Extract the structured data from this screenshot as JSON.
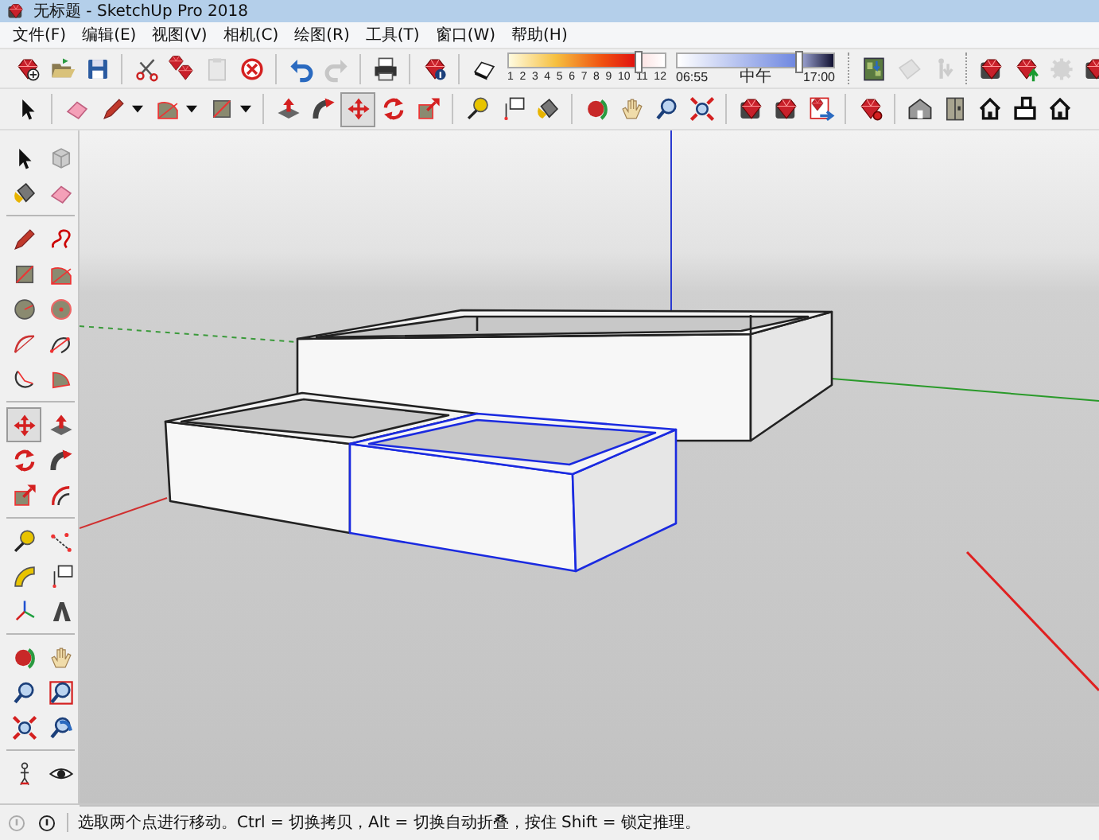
{
  "window": {
    "title": "无标题 - SketchUp Pro 2018"
  },
  "menu": [
    "文件(F)",
    "编辑(E)",
    "视图(V)",
    "相机(C)",
    "绘图(R)",
    "工具(T)",
    "窗口(W)",
    "帮助(H)"
  ],
  "toolbar_1": {
    "left_groups": [
      {
        "tools": [
          {
            "kind": "new",
            "disabled": false
          },
          {
            "kind": "open",
            "disabled": false
          },
          {
            "kind": "save",
            "disabled": false
          }
        ]
      },
      {
        "tools": [
          {
            "kind": "cut",
            "disabled": false
          },
          {
            "kind": "copy",
            "disabled": false
          },
          {
            "kind": "paste",
            "disabled": true
          },
          {
            "kind": "delete",
            "disabled": false
          }
        ]
      },
      {
        "tools": [
          {
            "kind": "undo",
            "disabled": false
          },
          {
            "kind": "redo",
            "disabled": true
          }
        ]
      },
      {
        "tools": [
          {
            "kind": "print",
            "disabled": false
          }
        ]
      },
      {
        "tools": [
          {
            "kind": "info",
            "disabled": false
          }
        ]
      },
      {
        "tools": [
          {
            "kind": "shadows",
            "disabled": false
          }
        ]
      }
    ],
    "shadow_settings": {
      "date_slider": {
        "labels": [
          "1",
          "2",
          "3",
          "4",
          "5",
          "6",
          "7",
          "8",
          "9",
          "10",
          "11",
          "12"
        ],
        "level": 0.83
      },
      "time_slider": {
        "labels": [
          "06:55",
          "中午",
          "17:00"
        ],
        "level": 0.78
      }
    },
    "right_groups": [
      {
        "tools": [
          {
            "kind": "matchphoto",
            "disabled": false
          },
          {
            "kind": "plane",
            "disabled": true
          },
          {
            "kind": "figure",
            "disabled": true
          }
        ]
      },
      {
        "tools": [
          {
            "kind": "ruby",
            "disabled": false
          },
          {
            "kind": "rubyup",
            "disabled": false
          },
          {
            "kind": "rubygear",
            "disabled": true
          },
          {
            "kind": "ruby",
            "disabled": false
          }
        ]
      }
    ]
  },
  "toolbar_2": {
    "groups": [
      {
        "tools": [
          {
            "kind": "select",
            "selected": false
          }
        ]
      },
      {
        "tools": [
          {
            "kind": "eraser",
            "selected": false
          },
          {
            "kind": "pencil",
            "selected": false,
            "dropdown": true
          },
          {
            "kind": "rotrect",
            "selected": false,
            "dropdown": true
          },
          {
            "kind": "rect",
            "selected": false,
            "dropdown": true
          }
        ]
      },
      {
        "tools": [
          {
            "kind": "push",
            "selected": false
          },
          {
            "kind": "follow",
            "selected": false
          },
          {
            "kind": "move",
            "selected": true
          },
          {
            "kind": "rotate",
            "selected": false
          },
          {
            "kind": "scale",
            "selected": false
          }
        ]
      },
      {
        "tools": [
          {
            "kind": "tape",
            "selected": false
          },
          {
            "kind": "text",
            "selected": false
          },
          {
            "kind": "paint",
            "selected": false
          }
        ]
      },
      {
        "tools": [
          {
            "kind": "orbit",
            "selected": false
          },
          {
            "kind": "pan",
            "selected": false
          },
          {
            "kind": "zoom",
            "selected": false
          },
          {
            "kind": "extents",
            "selected": false
          }
        ]
      },
      {
        "tools": [
          {
            "kind": "ruby",
            "selected": false
          },
          {
            "kind": "ruby",
            "selected": false
          },
          {
            "kind": "rubydoc",
            "selected": false
          }
        ]
      },
      {
        "tools": [
          {
            "kind": "rubypin",
            "selected": false
          }
        ]
      },
      {
        "tools": [
          {
            "kind": "house",
            "selected": false
          },
          {
            "kind": "door",
            "selected": false
          },
          {
            "kind": "houseout",
            "selected": false
          },
          {
            "kind": "housebox",
            "selected": false
          },
          {
            "kind": "houseout",
            "selected": false
          }
        ]
      }
    ]
  },
  "left_toolbar": {
    "groups": [
      {
        "tools": [
          {
            "kind": "select",
            "selected": false
          },
          {
            "kind": "component",
            "selected": false
          },
          {
            "kind": "paint",
            "selected": false
          },
          {
            "kind": "eraser",
            "selected": false
          }
        ]
      },
      {
        "tools": [
          {
            "kind": "pencil",
            "selected": false
          },
          {
            "kind": "freehand",
            "selected": false
          },
          {
            "kind": "rect",
            "selected": false
          },
          {
            "kind": "rotrect",
            "selected": false
          },
          {
            "kind": "circle",
            "selected": false
          },
          {
            "kind": "polygon",
            "selected": false
          },
          {
            "kind": "arc2",
            "selected": false
          },
          {
            "kind": "arc3",
            "selected": false
          },
          {
            "kind": "arc",
            "selected": false
          },
          {
            "kind": "pie",
            "selected": false
          }
        ]
      },
      {
        "tools": [
          {
            "kind": "move",
            "selected": true
          },
          {
            "kind": "push",
            "selected": false
          },
          {
            "kind": "rotate",
            "selected": false
          },
          {
            "kind": "follow",
            "selected": false
          },
          {
            "kind": "scale",
            "selected": false
          },
          {
            "kind": "offset",
            "selected": false
          }
        ]
      },
      {
        "tools": [
          {
            "kind": "tape",
            "selected": false
          },
          {
            "kind": "dimension",
            "selected": false
          },
          {
            "kind": "protractor",
            "selected": false
          },
          {
            "kind": "text",
            "selected": false
          },
          {
            "kind": "axes",
            "selected": false
          },
          {
            "kind": "text3d",
            "selected": false
          }
        ]
      },
      {
        "tools": [
          {
            "kind": "orbit",
            "selected": false
          },
          {
            "kind": "pan",
            "selected": false
          },
          {
            "kind": "zoom",
            "selected": false
          },
          {
            "kind": "zoomwin",
            "selected": false
          },
          {
            "kind": "extents",
            "selected": false
          },
          {
            "kind": "previous",
            "selected": false
          }
        ]
      },
      {
        "tools": [
          {
            "kind": "position",
            "selected": false
          },
          {
            "kind": "look",
            "selected": false
          }
        ]
      }
    ]
  },
  "model": {
    "boxes": [
      {
        "selected": false
      },
      {
        "selected": false
      },
      {
        "selected": true
      }
    ]
  },
  "status_bar": {
    "text": "选取两个点进行移动。Ctrl = 切换拷贝，Alt = 切换自动折叠，按住 Shift = 锁定推理。"
  }
}
